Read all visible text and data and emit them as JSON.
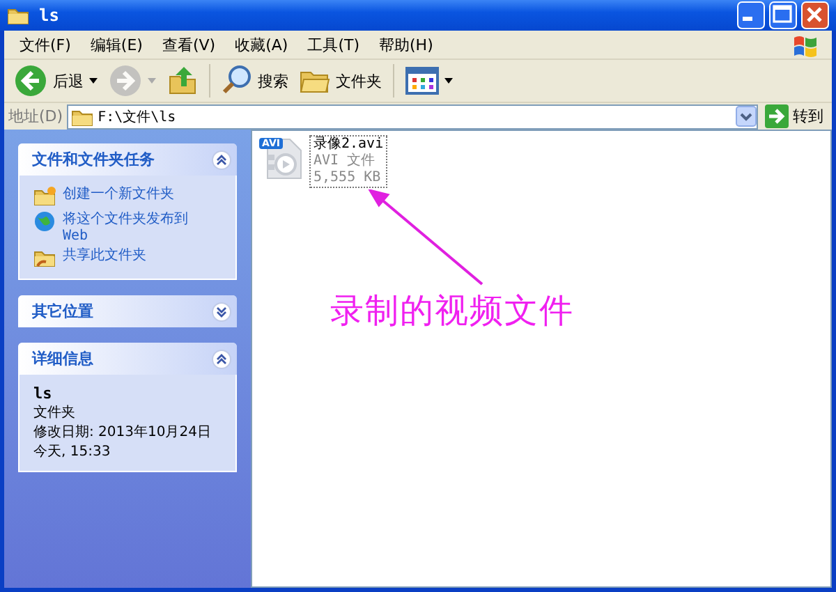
{
  "window": {
    "title": "ls"
  },
  "menu": [
    {
      "label": "文件(F)"
    },
    {
      "label": "编辑(E)"
    },
    {
      "label": "查看(V)"
    },
    {
      "label": "收藏(A)"
    },
    {
      "label": "工具(T)"
    },
    {
      "label": "帮助(H)"
    }
  ],
  "toolbar": [
    {
      "kind": "back",
      "label": "后退",
      "disabled": false
    },
    {
      "kind": "forward",
      "disabled": true
    },
    {
      "kind": "up",
      "disabled": false
    },
    {
      "kind": "search",
      "label": "搜索",
      "disabled": false
    },
    {
      "kind": "folders",
      "label": "文件夹",
      "disabled": false
    },
    {
      "kind": "views",
      "disabled": false
    }
  ],
  "address": {
    "label": "地址(D)",
    "value": "F:\\文件\\ls",
    "go": "转到"
  },
  "sidebar": [
    {
      "title": "文件和文件夹任务",
      "expanded": true,
      "kind": "tasks",
      "items": [
        {
          "kind": "new-folder",
          "text": "创建一个新文件夹"
        },
        {
          "kind": "globe",
          "text": "将这个文件夹发布到",
          "subtext": "Web"
        },
        {
          "kind": "share",
          "text": "共享此文件夹"
        }
      ]
    },
    {
      "title": "其它位置",
      "expanded": false
    },
    {
      "title": "详细信息",
      "expanded": true,
      "kind": "details",
      "name": "ls",
      "lines": [
        "文件夹",
        "修改日期: 2013年10月24日",
        "今天, 15:33"
      ]
    }
  ],
  "files": [
    {
      "badge": "AVI",
      "name": "录像2.avi",
      "type": "AVI 文件",
      "size": "5,555 KB"
    }
  ],
  "annotation": {
    "text": "录制的视频文件"
  }
}
